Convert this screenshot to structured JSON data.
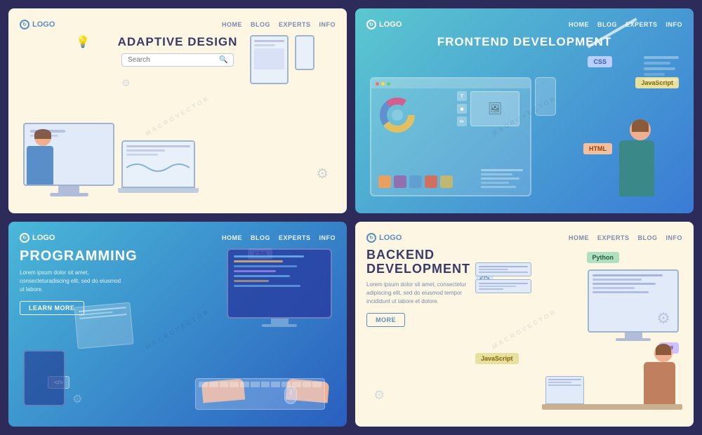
{
  "cards": [
    {
      "id": "adaptive-design",
      "title": "ADAPTIVE DESIGN",
      "logo": "LOGO",
      "nav": [
        "HOME",
        "BLOG",
        "EXPERTS",
        "INFO"
      ],
      "search_placeholder": "Search",
      "theme": "light",
      "desc": "",
      "button": null
    },
    {
      "id": "frontend-development",
      "title": "FRONTEND DEVELOPMENT",
      "logo": "LOGO",
      "nav": [
        "HOME",
        "BLOG",
        "EXPERTS",
        "INFO"
      ],
      "theme": "dark",
      "badges": [
        "CSS",
        "JavaScript",
        "HTML"
      ],
      "desc": "",
      "button": null
    },
    {
      "id": "programming",
      "title": "PROGRAMMING",
      "logo": "LOGO",
      "nav": [
        "HOME",
        "BLOG",
        "EXPERTS",
        "INFO"
      ],
      "theme": "dark",
      "badges": [
        "CSS",
        "</>"
      ],
      "desc": "Lorem ipsum dolor sit amet, consecteturadiscing elit, sed do eiusmod ut labore.",
      "button": "LEARN MORE"
    },
    {
      "id": "backend-development",
      "title": "BACKEND\nDEVELOPMENT",
      "logo": "LOGO",
      "nav": [
        "HOME",
        "EXPERTS",
        "BLOG",
        "INFO"
      ],
      "theme": "light",
      "badges": [
        "Python",
        "JavaScript",
        "C#"
      ],
      "desc": "Lorem ipsum dolor sit amet, consectetur adipiscing elit, sed do eiusmod tempor incididunt ut labore et dolore.",
      "button": "MORE"
    }
  ],
  "watermark": "MACROVECTOR"
}
